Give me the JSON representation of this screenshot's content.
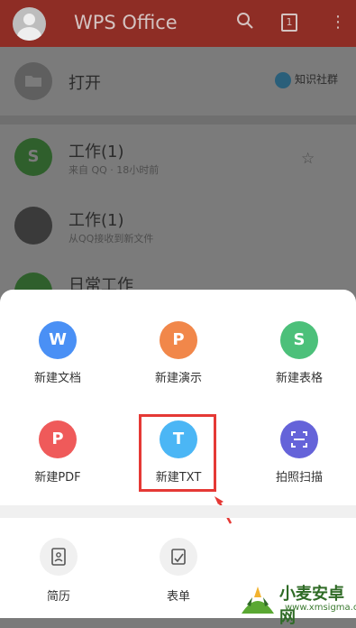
{
  "app": {
    "title": "WPS Office",
    "notification_count": "1"
  },
  "list": {
    "open": {
      "label": "打开",
      "community": "知识社群"
    },
    "files": [
      {
        "title": "工作(1)",
        "subtitle": "来自 QQ · 18小时前",
        "color": "#2f5f2c"
      },
      {
        "title": "工作(1)",
        "subtitle": "从QQ接收到新文件",
        "color": "#3a3a3a"
      },
      {
        "title": "日常工作",
        "subtitle": "",
        "color": "#2f5f2c"
      }
    ]
  },
  "sheet": {
    "row1": [
      {
        "label": "新建文档",
        "letter": "W",
        "color": "#4a90f5"
      },
      {
        "label": "新建演示",
        "letter": "P",
        "color": "#f1874a"
      },
      {
        "label": "新建表格",
        "letter": "S",
        "color": "#4cc07a"
      }
    ],
    "row2": [
      {
        "label": "新建PDF",
        "letter": "P",
        "color": "#ef5a5a"
      },
      {
        "label": "新建TXT",
        "letter": "T",
        "color": "#4bb6f5"
      },
      {
        "label": "拍照扫描",
        "letter": "",
        "color": "#6563d9"
      }
    ],
    "bottom": [
      {
        "label": "简历"
      },
      {
        "label": "表单"
      }
    ]
  },
  "watermark": {
    "title": "小麦安卓网",
    "url": "www.xmsigma.com"
  }
}
